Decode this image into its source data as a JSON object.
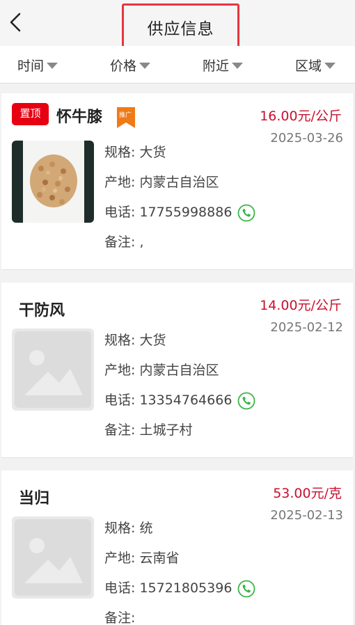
{
  "header": {
    "title": "供应信息",
    "back_icon": "chevron-left-icon"
  },
  "filters": [
    {
      "label": "时间"
    },
    {
      "label": "价格"
    },
    {
      "label": "附近"
    },
    {
      "label": "区域"
    }
  ],
  "colors": {
    "accent": "#e8343f",
    "price": "#c8102e",
    "phone": "#3bb54a",
    "top_badge": "#e60012",
    "promo_badge": "#f07a16"
  },
  "listings": [
    {
      "name": "怀牛膝",
      "top_badge": "置顶",
      "promo_badge": "推广",
      "price": "16.00元/公斤",
      "date": "2025-03-26",
      "spec": "规格: 大货",
      "origin": "产地: 内蒙古自治区",
      "phone": "电话: 17755998886",
      "note": "备注: ,"
    },
    {
      "name": "干防风",
      "price": "14.00元/公斤",
      "date": "2025-02-12",
      "spec": "规格: 大货",
      "origin": "产地: 内蒙古自治区",
      "phone": "电话: 13354764666",
      "note": "备注: 土城子村"
    },
    {
      "name": "当归",
      "price": "53.00元/克",
      "date": "2025-02-13",
      "spec": "规格: 统",
      "origin": "产地: 云南省",
      "phone": "电话: 15721805396",
      "note": "备注:"
    }
  ]
}
